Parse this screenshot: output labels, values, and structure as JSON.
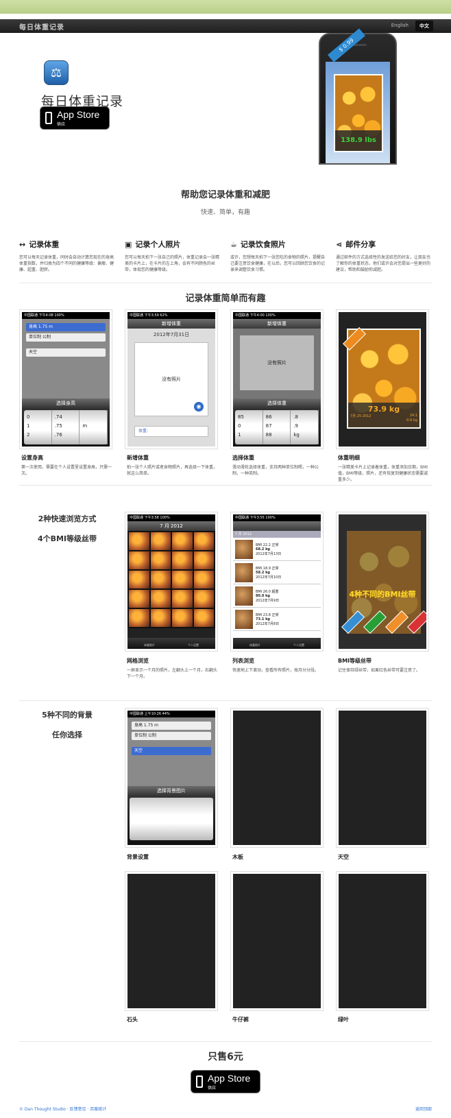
{
  "nav": {
    "brand": "每日体重记录",
    "lang_en": "English",
    "lang_zh": "中文"
  },
  "hero": {
    "title": "每日体重记录",
    "app_store_big": "App Store",
    "app_store_small": "供应",
    "price_badge": "$ 0.99",
    "phone_weight": "138.9 lbs"
  },
  "intro": {
    "title": "帮助您记录体重和减肥",
    "subtitle": "快速、简单，有趣"
  },
  "features": [
    {
      "icon": "arrows-icon",
      "title": "记录体重",
      "desc": "您可以每天记录体重，同时会自动计算您现在的身高体重指数，并归类为四个不同的健康等级：偏瘦、健康、超重、肥胖。"
    },
    {
      "icon": "picture-icon",
      "title": "记录个人照片",
      "desc": "您可以每天拍下一张自己的照片，体重记录会一张精美的卡片上，在卡片的左上角，会有不同颜色的丝带，体现您的健康等级。"
    },
    {
      "icon": "food-icon",
      "title": "记录饮食照片",
      "desc": "或许，您想每天拍下一张您吃的食物的照片，提醒自己要注意饮食健康，在以后，您可以回顾您饮食的记录来调整饮食习惯。"
    },
    {
      "icon": "share-icon",
      "title": "邮件分享",
      "desc": "通过邮件的方式选择性的发送给您的好友，让朋友也了解你的体重状态，他们或许会对您提出一些更好的建议，帮助和鼓励你减肥。"
    }
  ],
  "simple": {
    "title": "记录体重简单而有趣",
    "items": [
      {
        "title": "设置身高",
        "desc": "第一次使用，需要在个人设置里设置身高，只需一次。"
      },
      {
        "title": "新增体重",
        "desc": "拍一张个人照片或者食物照片，再选择一下体重，就这么简单。"
      },
      {
        "title": "选择体重",
        "desc": "滑动滑轮选择体重，支持两种单位制嗯，一种公制，一种英制。"
      },
      {
        "title": "体重明细",
        "desc": "一张精美卡片上记录着体重，体重添加日期，BMI值，BMI等级，照片，还有恢复到健康状态需要减重多少。"
      }
    ]
  },
  "screens": {
    "s1": {
      "status": "中国联通  下午4:08  100%",
      "pbar": "选择身高",
      "cancel": "取消",
      "done": "完成",
      "rows": [
        "身高  1.75 m",
        "单位制  公制",
        "天空"
      ],
      "cols": [
        [
          "0",
          "1",
          "2"
        ],
        [
          ".74",
          ".75",
          ".76"
        ],
        [
          "",
          "m",
          ""
        ]
      ]
    },
    "s2": {
      "status": "中国联通  下午3:59  62%",
      "nav": "新增体重",
      "back": "取消",
      "date": "2012年7月31日",
      "nophoto": "没有照片",
      "field": "体重:"
    },
    "s3": {
      "status": "中国联通  下午4:00  100%",
      "nav": "新增体重",
      "nophoto": "没有照片",
      "pbar": "选择体重",
      "cols": [
        [
          "85",
          "0",
          "1"
        ],
        [
          "86",
          "87",
          "88"
        ],
        [
          ".8",
          ".9",
          "kg"
        ]
      ]
    },
    "s4": {
      "weight": "73.9 kg",
      "date": "7月 25 2012",
      "bmi": "24.1",
      "delta": "-0.6 kg"
    }
  },
  "browse": {
    "side_title1": "2种快速浏览方式",
    "side_title2": "4个BMI等级丝带",
    "items": [
      {
        "title": "网格浏览",
        "desc": "一屏显示一个月的照片，左翻头上一个月，右翻头下一个月。"
      },
      {
        "title": "列表浏览",
        "desc": "快速地上下滚动，查看所有照片，按月分分段。"
      },
      {
        "title": "BMI等级丝带",
        "desc": "记住保持绿丝带，如果红色丝带可要注意了。"
      }
    ],
    "grid_header": "7 月 2012",
    "list_header": "7 月 2012",
    "list_rows": [
      {
        "bmi": "BMI 22.2 正常",
        "kg": "68.2 kg",
        "date": "2012年7月13日"
      },
      {
        "bmi": "BMI 18.9 正常",
        "kg": "58.2 kg",
        "date": "2012年7月10日"
      },
      {
        "bmi": "BMI 26.0 超重",
        "kg": "80.0 kg",
        "date": "2012年7月9日"
      },
      {
        "bmi": "BMI 23.8 正常",
        "kg": "73.1 kg",
        "date": "2012年7月8日"
      }
    ],
    "ribbon_text": "4种不同的BMI丝带",
    "tab1": "体重照片",
    "tab2": "个人设置"
  },
  "backgrounds": {
    "side_title1": "5种不同的背景",
    "side_title2": "任你选择",
    "picker_title": "选择背景图片",
    "items": [
      "背景设置",
      "木板",
      "天空",
      "石头",
      "牛仔裤",
      "绿叶"
    ]
  },
  "buy": {
    "title": "只售6元",
    "app_store_big": "App Store",
    "app_store_small": "供应"
  },
  "footer": {
    "left": "© Dan Thought Studio · 反馈意见 · 百度统计",
    "right": "返回顶部"
  },
  "colors": {
    "accent": "#2a6fd0",
    "ribbon_blue": "#2d8ad1",
    "ribbon_green": "#1c9a2c",
    "ribbon_orange": "#ee8a1e",
    "ribbon_red": "#d8262a"
  }
}
